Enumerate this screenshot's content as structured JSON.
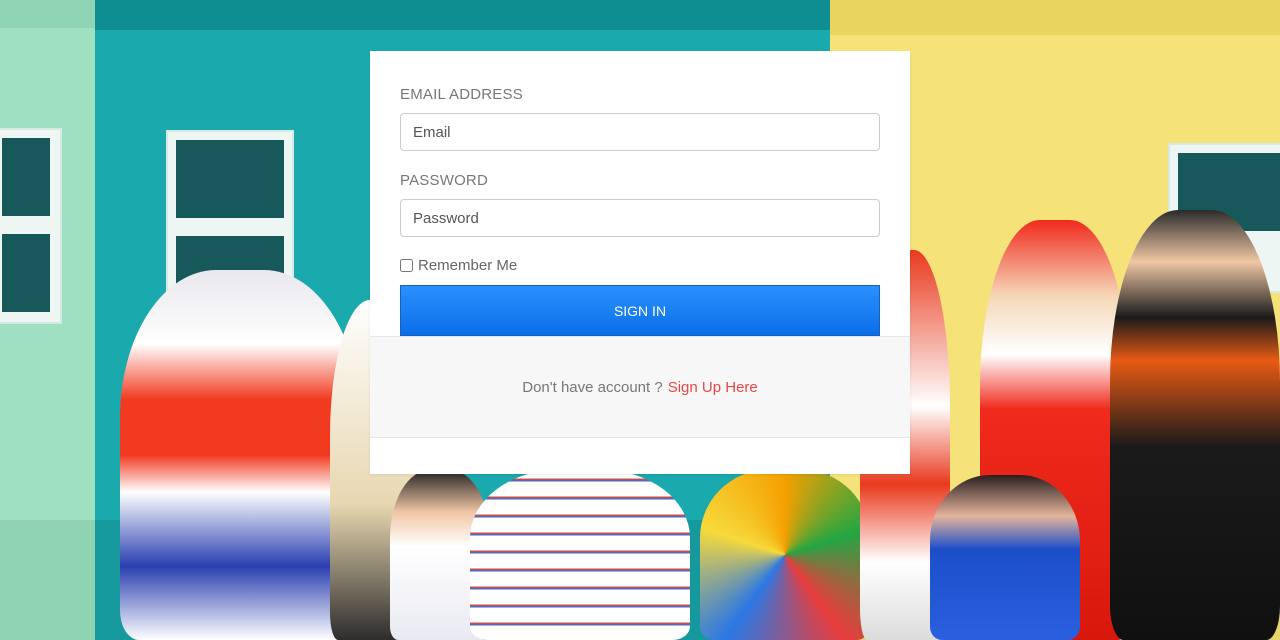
{
  "login": {
    "email_label": "EMAIL ADDRESS",
    "email_placeholder": "Email",
    "password_label": "PASSWORD",
    "password_placeholder": "Password",
    "remember_label": "Remember Me",
    "remember_checked": false,
    "signin_label": "SIGN IN"
  },
  "footer": {
    "prompt": "Don't have account ?",
    "signup_link": "Sign Up Here"
  },
  "background": {
    "description_colors": {
      "green_wall": "#9fe0c2",
      "teal_wall": "#1aa9ad",
      "yellow_wall": "#f5e37a"
    }
  },
  "colors": {
    "button": "#1a80f5",
    "link": "#e84646",
    "label": "#777777"
  }
}
